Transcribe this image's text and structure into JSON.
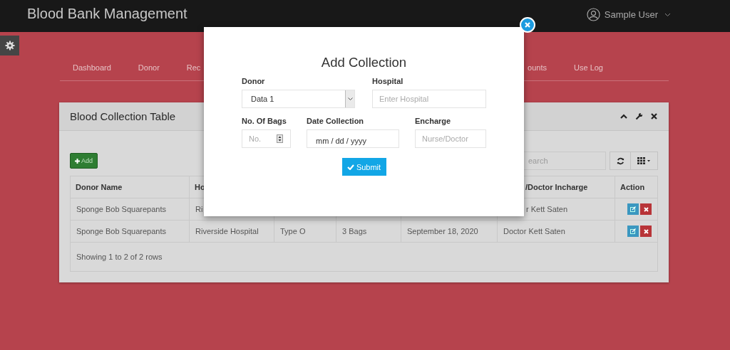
{
  "header": {
    "title": "Blood Bank Management",
    "user": "Sample User"
  },
  "nav": {
    "left": [
      {
        "label": "Dashboard"
      },
      {
        "label": "Donor"
      },
      {
        "label": "Rec"
      }
    ],
    "right": [
      {
        "label": "ounts"
      },
      {
        "label": "Use Log"
      }
    ]
  },
  "panel": {
    "title": "Blood Collection Table",
    "add_button": "Add",
    "search": {
      "placeholder": "earch"
    },
    "columns": [
      {
        "label": "Donor Name"
      },
      {
        "label": "Ho"
      },
      {},
      {},
      {},
      {
        "label": "/Doctor Incharge"
      },
      {
        "label": "Action"
      }
    ],
    "rows": [
      {
        "cells": [
          {
            "text": "Sponge Bob Squarepants"
          },
          {
            "text": "Ri"
          },
          {},
          {},
          {},
          {
            "text": "r Kett Saten"
          }
        ]
      },
      {
        "cells": [
          {
            "text": "Sponge Bob Squarepants"
          },
          {
            "text": "Riverside Hospital"
          },
          {
            "text": "Type O"
          },
          {
            "text": "3 Bags"
          },
          {
            "text": "September 18, 2020"
          },
          {
            "text": "Doctor Kett Saten"
          }
        ]
      }
    ],
    "footer": "Showing 1 to 2 of 2 rows"
  },
  "modal": {
    "title": "Add Collection",
    "rows": [
      [
        {
          "kind": "select",
          "label": "Donor",
          "value": "Data 1"
        },
        {
          "kind": "text",
          "label": "Hospital",
          "placeholder": "Enter Hospital"
        }
      ],
      [
        {
          "kind": "number",
          "label": "No. Of Bags",
          "placeholder": "No."
        },
        {
          "kind": "date",
          "label": "Date Collection",
          "value": "mm / dd / yyyy"
        },
        {
          "kind": "text",
          "label": "Encharge",
          "placeholder": "Nurse/Doctor"
        }
      ]
    ],
    "submit": "Submit"
  }
}
